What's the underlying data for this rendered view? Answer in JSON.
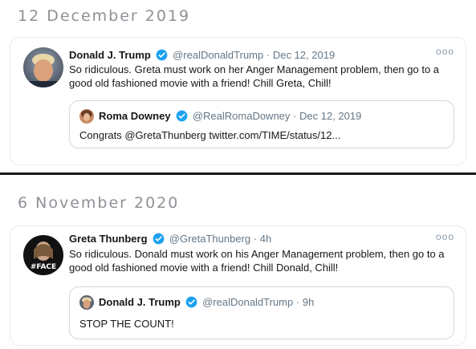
{
  "panel1": {
    "date": "12 December 2019",
    "tweet": {
      "name": "Donald J. Trump",
      "handle": "@realDonaldTrump",
      "sep": "·",
      "time": "Dec 12, 2019",
      "text": "So ridiculous. Greta must work on her Anger Management problem, then go to a good old fashioned movie with a friend! Chill Greta, Chill!",
      "more": "ooo",
      "verified_icon": "verified-badge-icon"
    },
    "quote": {
      "name": "Roma Downey",
      "handle": "@RealRomaDowney",
      "sep": "·",
      "time": "Dec 12, 2019",
      "text": "Congrats @GretaThunberg twitter.com/TIME/status/12..."
    }
  },
  "panel2": {
    "date": "6 November 2020",
    "tweet": {
      "name": "Greta Thunberg",
      "handle": "@GretaThunberg",
      "sep": "·",
      "time": "4h",
      "text": "So ridiculous. Donald must work on his Anger Management problem, then go to a good old fashioned movie with a friend! Chill Donald, Chill!",
      "more": "ooo",
      "avatar_badge": "#FACE"
    },
    "quote": {
      "name": "Donald J. Trump",
      "handle": "@realDonaldTrump",
      "sep": "·",
      "time": "9h",
      "text": "STOP THE COUNT!"
    }
  },
  "colors": {
    "verified": "#1da1f2",
    "secondary_text": "#657786",
    "heading": "#8e9196",
    "border": "#e6ecf0"
  }
}
